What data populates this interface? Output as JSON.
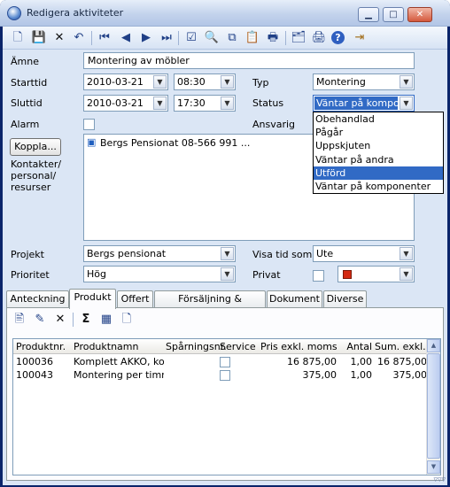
{
  "window": {
    "title": "Redigera aktiviteter",
    "minimize": "▁",
    "maximize": "□",
    "close": "✕"
  },
  "toolbar": {
    "icons": [
      "new-doc-icon",
      "save-icon",
      "delete-icon",
      "undo-icon",
      "first-record-icon",
      "previous-record-icon",
      "next-record-icon",
      "last-record-icon",
      "check-icon",
      "zoom-icon",
      "copy-icon",
      "paste-icon",
      "print-icon",
      "properties-icon",
      "printer-icon",
      "help-icon",
      "exit-icon"
    ],
    "glyphs": [
      "🗋",
      "💾",
      "✕",
      "↶",
      "⏮",
      "◀",
      "▶",
      "⏭",
      "☑",
      "🔍",
      "⧉",
      "📋",
      "🖶",
      "🗂",
      "🖨",
      "?",
      "⇥"
    ]
  },
  "form": {
    "amne_label": "Ämne",
    "amne_value": "Montering av möbler",
    "starttid_label": "Starttid",
    "start_date": "2010-03-21",
    "start_time": "08:30",
    "typ_label": "Typ",
    "typ_value": "Montering",
    "sluttid_label": "Sluttid",
    "end_date": "2010-03-21",
    "end_time": "17:30",
    "status_label": "Status",
    "status_value": "Väntar på kompone",
    "alarm_label": "Alarm",
    "ansvarig_label": "Ansvarig",
    "koppla_button": "Koppla...",
    "kontakter_label_1": "Kontakter/",
    "kontakter_label_2": "personal/",
    "kontakter_label_3": "resurser",
    "contact_entry": "Bergs Pensionat 08-566 991 ...",
    "projekt_label": "Projekt",
    "projekt_value": "Bergs pensionat",
    "visa_tid_label": "Visa tid som",
    "visa_tid_value": "Ute",
    "prioritet_label": "Prioritet",
    "prioritet_value": "Hög",
    "privat_label": "Privat",
    "color_value": "#d42a12"
  },
  "status_dropdown": {
    "options": [
      "Obehandlad",
      "Pågår",
      "Uppskjuten",
      "Väntar på andra",
      "Utförd",
      "Väntar på komponenter"
    ],
    "highlighted": "Utförd"
  },
  "tabs": [
    "Anteckning",
    "Produkt",
    "Offert",
    "Försäljning & fakturering",
    "Dokument",
    "Diverse"
  ],
  "active_tab": "Produkt",
  "product_toolbar": {
    "icons": [
      "add-product-icon",
      "edit-icon",
      "delete-icon",
      "sum-icon",
      "inventory-icon",
      "document-icon"
    ],
    "glyphs": [
      "🖹",
      "✎",
      "✕",
      "Σ",
      "▦",
      "🗋"
    ]
  },
  "product_table": {
    "columns": [
      "Produktnr.",
      "Produktnamn",
      "Spårningsnr.",
      "Service",
      "Pris exkl. moms",
      "Antal",
      "Sum. exkl. rF"
    ],
    "rows": [
      {
        "produktnr": "100036",
        "namn": "Komplett AKKO, kon",
        "sparningsnr": "",
        "service": false,
        "pris": "16 875,00",
        "antal": "1,00",
        "summa": "16 875,00"
      },
      {
        "produktnr": "100043",
        "namn": "Montering per timme",
        "sparningsnr": "",
        "service": false,
        "pris": "375,00",
        "antal": "1,00",
        "summa": "375,00"
      }
    ]
  },
  "accent_color": "#316ac5"
}
